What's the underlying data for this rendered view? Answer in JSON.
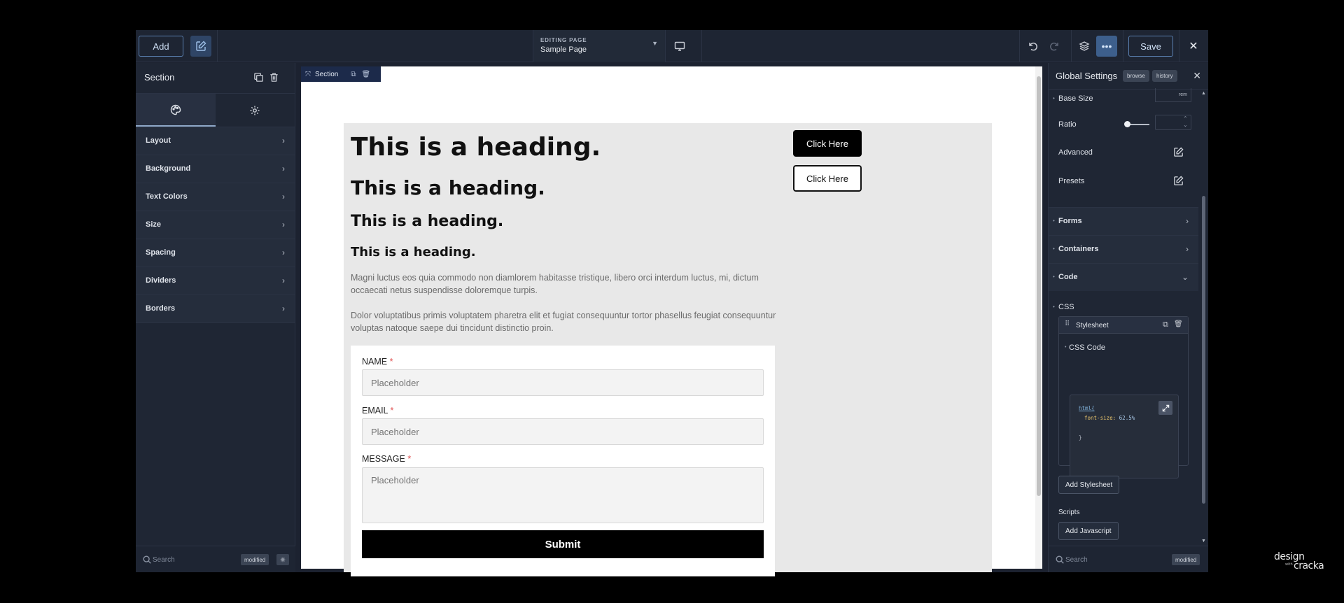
{
  "topbar": {
    "add_label": "Add",
    "editing_label": "EDITING PAGE",
    "editing_value": "Sample Page",
    "save_label": "Save"
  },
  "left_panel": {
    "title": "Section",
    "items": [
      {
        "label": "Layout"
      },
      {
        "label": "Background"
      },
      {
        "label": "Text Colors"
      },
      {
        "label": "Size"
      },
      {
        "label": "Spacing"
      },
      {
        "label": "Dividers"
      },
      {
        "label": "Borders"
      }
    ],
    "search_placeholder": "Search",
    "modified_badge": "modified"
  },
  "canvas": {
    "section_tag": "Section",
    "headings": [
      "This is a heading.",
      "This is a heading.",
      "This is a heading.",
      "This is a heading."
    ],
    "para1": "Magni luctus eos quia commodo non diamlorem habitasse tristique, libero orci interdum luctus, mi, dictum occaecati netus suspendisse doloremque turpis.",
    "para2": "Dolor voluptatibus primis voluptatem pharetra elit et fugiat consequuntur tortor phasellus feugiat consequuntur voluptas natoque saepe dui tincidunt distinctio proin.",
    "button_primary": "Click Here",
    "button_secondary": "Click Here",
    "form": {
      "fields": [
        {
          "label": "NAME",
          "placeholder": "Placeholder"
        },
        {
          "label": "EMAIL",
          "placeholder": "Placeholder"
        },
        {
          "label": "MESSAGE",
          "placeholder": "Placeholder"
        }
      ],
      "required_mark": "*",
      "submit_label": "Submit"
    }
  },
  "right_panel": {
    "title": "Global Settings",
    "browse_chip": "browse",
    "history_chip": "history",
    "base_size_label": "Base Size",
    "base_size_unit": "rem",
    "ratio_label": "Ratio",
    "advanced_label": "Advanced",
    "presets_label": "Presets",
    "accordions": [
      {
        "label": "Forms"
      },
      {
        "label": "Containers"
      },
      {
        "label": "Code"
      }
    ],
    "css_label": "CSS",
    "stylesheet_label": "Stylesheet",
    "css_code_label": "CSS Code",
    "code_lines": [
      "html{",
      "font-size:",
      "62.5%",
      "}"
    ],
    "add_stylesheet": "Add Stylesheet",
    "scripts_label": "Scripts",
    "add_javascript": "Add Javascript",
    "search_placeholder": "Search",
    "modified_badge": "modified"
  },
  "watermark": {
    "line1": "design",
    "line2": "cracka",
    "line3": "with"
  }
}
